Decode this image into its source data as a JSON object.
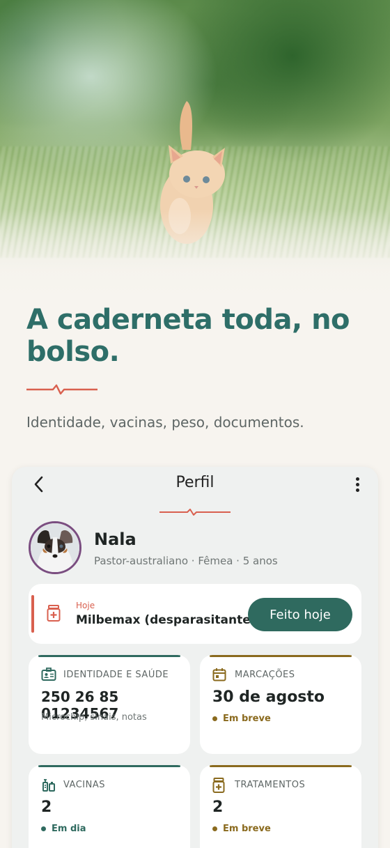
{
  "hero": {
    "headline": "A caderneta toda, no bolso.",
    "subline": "Identidade, vacinas, peso, documentos."
  },
  "header": {
    "title": "Perfil",
    "back_icon": "chevron-left-icon",
    "more_icon": "more-vertical-icon"
  },
  "pet": {
    "name": "Nala",
    "meta": "Pastor-australiano · Fêmea · 5 anos"
  },
  "today": {
    "label": "Hoje",
    "task": "Milbemax (desparasitante)",
    "button": "Feito hoje"
  },
  "tiles": [
    {
      "icon": "id-card-icon",
      "label": "IDENTIDADE E SAÚDE",
      "value": "250 26 85 01234567",
      "sub": "Microchip, sinais, notas",
      "color": "#2f6a5f"
    },
    {
      "icon": "calendar-icon",
      "label": "MARCAÇÕES",
      "value": "30 de agosto",
      "status": "Em breve",
      "color": "#8a6a1e"
    },
    {
      "icon": "syringe-icon",
      "label": "VACINAS",
      "value": "2",
      "status": "Em dia",
      "color": "#2f6a5f"
    },
    {
      "icon": "medicine-icon",
      "label": "TRATAMENTOS",
      "value": "2",
      "status": "Em breve",
      "color": "#8a6a1e"
    }
  ],
  "colors": {
    "accent": "#2e6e68",
    "brand_dark": "#2f6a5f",
    "alert": "#d9604f",
    "gold": "#8a6a1e"
  }
}
